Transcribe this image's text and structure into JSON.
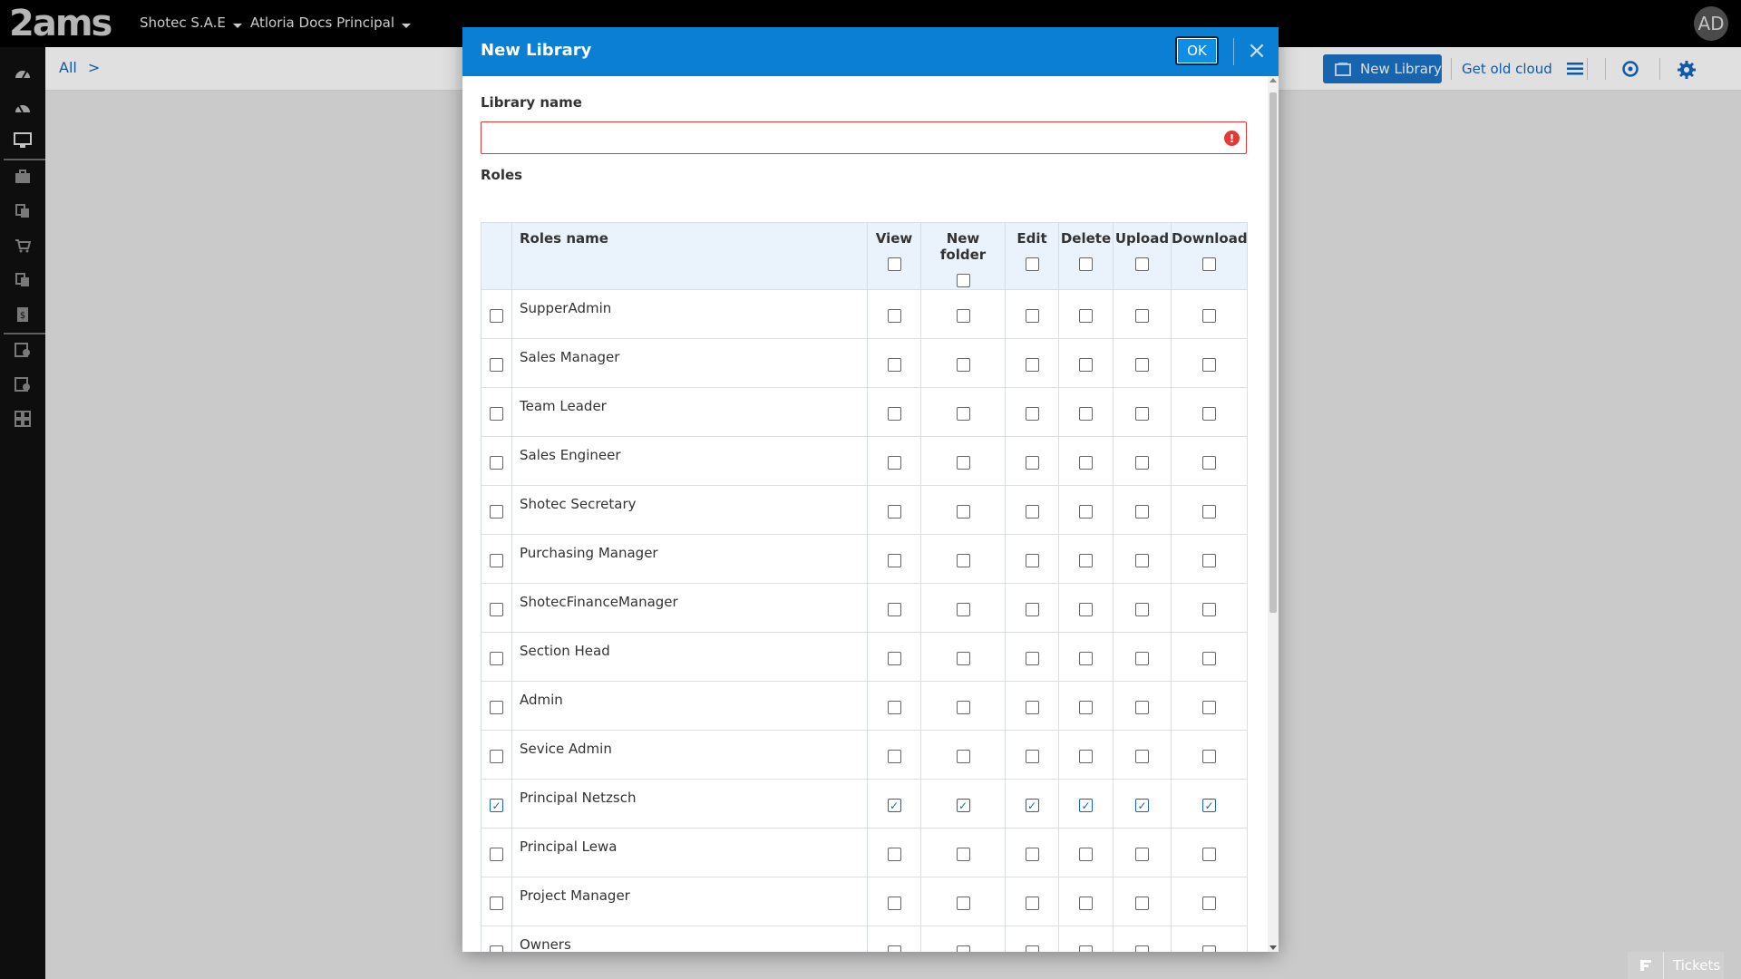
{
  "app": {
    "logo_text": "2ams",
    "company_menu": "Shotec S.A.E",
    "workspace_menu": "Atloria Docs Principal",
    "avatar_initials": "AD"
  },
  "sidebar": {
    "icons": [
      "dashboard-icon",
      "dashboard-alt-icon",
      "monitor-icon",
      "briefcase-icon",
      "documents-icon",
      "cart-icon",
      "documents-alt-icon",
      "invoice-icon",
      "report-check-icon",
      "report-settings-icon",
      "grid-icon"
    ]
  },
  "subheader": {
    "breadcrumb_root": "All",
    "breadcrumb_separator": ">",
    "new_library_label": "New Library",
    "old_cloud_label": "Get old cloud"
  },
  "dialog": {
    "title": "New Library",
    "ok_label": "OK",
    "close_glyph": "×",
    "library_name_label": "Library name",
    "library_name_value": "",
    "error_glyph": "!",
    "roles_label": "Roles",
    "columns": [
      "Roles name",
      "View",
      "New folder",
      "Edit",
      "Delete",
      "Upload",
      "Download"
    ],
    "roles": [
      {
        "name": "SupperAdmin",
        "selected": false,
        "view": false,
        "new_folder": false,
        "edit": false,
        "delete": false,
        "upload": false,
        "download": false
      },
      {
        "name": "Sales Manager",
        "selected": false,
        "view": false,
        "new_folder": false,
        "edit": false,
        "delete": false,
        "upload": false,
        "download": false
      },
      {
        "name": "Team Leader",
        "selected": false,
        "view": false,
        "new_folder": false,
        "edit": false,
        "delete": false,
        "upload": false,
        "download": false
      },
      {
        "name": "Sales Engineer",
        "selected": false,
        "view": false,
        "new_folder": false,
        "edit": false,
        "delete": false,
        "upload": false,
        "download": false
      },
      {
        "name": "Shotec Secretary",
        "selected": false,
        "view": false,
        "new_folder": false,
        "edit": false,
        "delete": false,
        "upload": false,
        "download": false
      },
      {
        "name": "Purchasing Manager",
        "selected": false,
        "view": false,
        "new_folder": false,
        "edit": false,
        "delete": false,
        "upload": false,
        "download": false
      },
      {
        "name": "ShotecFinanceManager",
        "selected": false,
        "view": false,
        "new_folder": false,
        "edit": false,
        "delete": false,
        "upload": false,
        "download": false
      },
      {
        "name": "Section Head",
        "selected": false,
        "view": false,
        "new_folder": false,
        "edit": false,
        "delete": false,
        "upload": false,
        "download": false
      },
      {
        "name": "Admin",
        "selected": false,
        "view": false,
        "new_folder": false,
        "edit": false,
        "delete": false,
        "upload": false,
        "download": false
      },
      {
        "name": "Sevice Admin",
        "selected": false,
        "view": false,
        "new_folder": false,
        "edit": false,
        "delete": false,
        "upload": false,
        "download": false
      },
      {
        "name": "Principal Netzsch",
        "selected": true,
        "view": true,
        "new_folder": true,
        "edit": true,
        "delete": true,
        "upload": true,
        "download": true
      },
      {
        "name": "Principal Lewa",
        "selected": false,
        "view": false,
        "new_folder": false,
        "edit": false,
        "delete": false,
        "upload": false,
        "download": false
      },
      {
        "name": "Project Manager",
        "selected": false,
        "view": false,
        "new_folder": false,
        "edit": false,
        "delete": false,
        "upload": false,
        "download": false
      },
      {
        "name": "Owners",
        "selected": false,
        "view": false,
        "new_folder": false,
        "edit": false,
        "delete": false,
        "upload": false,
        "download": false
      }
    ]
  },
  "footer": {
    "tickets_label": "Tickets"
  },
  "colors": {
    "dialog_header": "#0b7fd4",
    "primary_button": "#1a73c7",
    "link": "#1565c0",
    "error": "#e53935",
    "table_header_bg": "#eaf2fb"
  }
}
